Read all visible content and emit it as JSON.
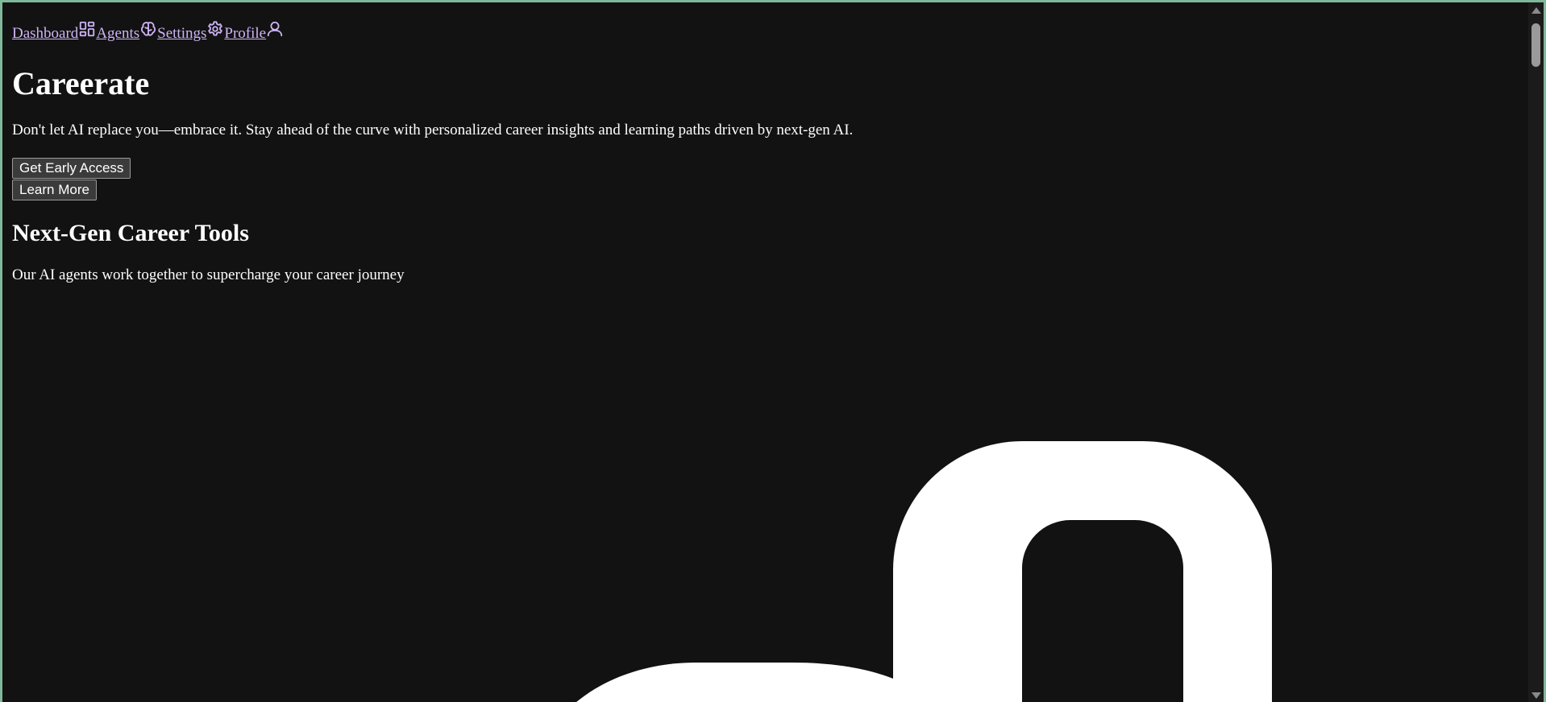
{
  "nav": {
    "items": [
      {
        "label": "Dashboard",
        "icon": "layout-dashboard-icon"
      },
      {
        "label": "Agents",
        "icon": "brain-icon"
      },
      {
        "label": "Settings",
        "icon": "gear-icon"
      },
      {
        "label": "Profile",
        "icon": "user-icon"
      }
    ]
  },
  "hero": {
    "title": "Careerate",
    "tagline": "Don't let AI replace you—embrace it. Stay ahead of the curve with personalized career insights and learning paths driven by next-gen AI.",
    "primary_button": "Get Early Access",
    "secondary_button": "Learn More"
  },
  "features": {
    "heading": "Next-Gen Career Tools",
    "subtitle": "Our AI agents work together to supercharge your career journey"
  },
  "colors": {
    "background": "#121212",
    "text": "#ffffff",
    "link": "#cdb4f5",
    "frame": "#7fb99a"
  }
}
